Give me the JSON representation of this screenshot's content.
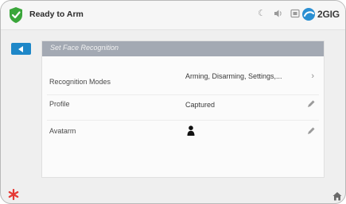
{
  "status_bar": {
    "status_text": "Ready to Arm",
    "status_icon": "shield-check-icon",
    "status_color": "#3aa63a",
    "icons": [
      "moon-icon",
      "speaker-icon",
      "camera-icon"
    ],
    "brand": "2GIG"
  },
  "nav": {
    "back_icon": "back-arrow-icon",
    "accent": "#1e87c8"
  },
  "panel": {
    "title": "Set Face Recognition",
    "header_color": "#a3a9b3",
    "rows": [
      {
        "label": "Recognition Modes",
        "value": "Arming, Disarming, Settings,...",
        "action_icon": "chevron-right-icon"
      },
      {
        "label": "Profile",
        "value": "Captured",
        "action_icon": "pencil-icon"
      },
      {
        "label": "Avatarm",
        "value": "",
        "value_icon": "person-icon",
        "action_icon": "pencil-icon"
      }
    ]
  },
  "bottom_bar": {
    "emergency_icon": "asterisk-icon",
    "emergency_color": "#e53935",
    "home_icon": "home-icon"
  }
}
